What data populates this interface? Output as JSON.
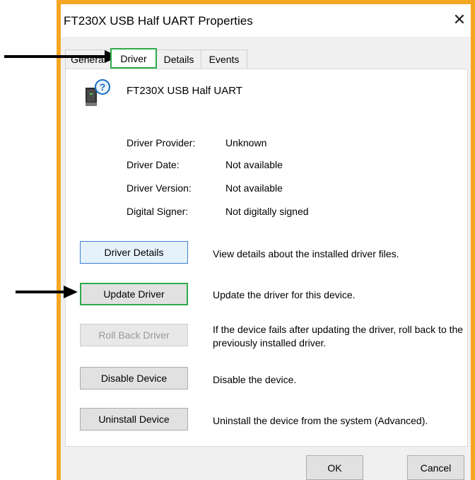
{
  "window": {
    "title": "FT230X USB Half UART Properties",
    "close_glyph": "✕"
  },
  "tabs": [
    {
      "label": "General",
      "active": false
    },
    {
      "label": "Driver",
      "active": true
    },
    {
      "label": "Details",
      "active": false
    },
    {
      "label": "Events",
      "active": false
    }
  ],
  "device": {
    "icon": "unknown-device-icon",
    "name": "FT230X USB Half UART"
  },
  "properties": [
    {
      "label": "Driver Provider:",
      "value": "Unknown"
    },
    {
      "label": "Driver Date:",
      "value": "Not available"
    },
    {
      "label": "Driver Version:",
      "value": "Not available"
    },
    {
      "label": "Digital Signer:",
      "value": "Not digitally signed"
    }
  ],
  "actions": [
    {
      "label": "Driver Details",
      "description": "View details about the installed driver files."
    },
    {
      "label": "Update Driver",
      "description": "Update the driver for this device."
    },
    {
      "label": "Roll Back Driver",
      "description": "If the device fails after updating the driver, roll back to the previously installed driver.",
      "disabled": true
    },
    {
      "label": "Disable Device",
      "description": "Disable the device."
    },
    {
      "label": "Uninstall Device",
      "description": "Uninstall the device from the system (Advanced)."
    }
  ],
  "footer": {
    "ok_label": "OK",
    "cancel_label": "Cancel"
  },
  "colors": {
    "annotation_frame": "#f5a623",
    "highlight_box": "#2faa4a",
    "annotation_arrow": "#000000"
  }
}
